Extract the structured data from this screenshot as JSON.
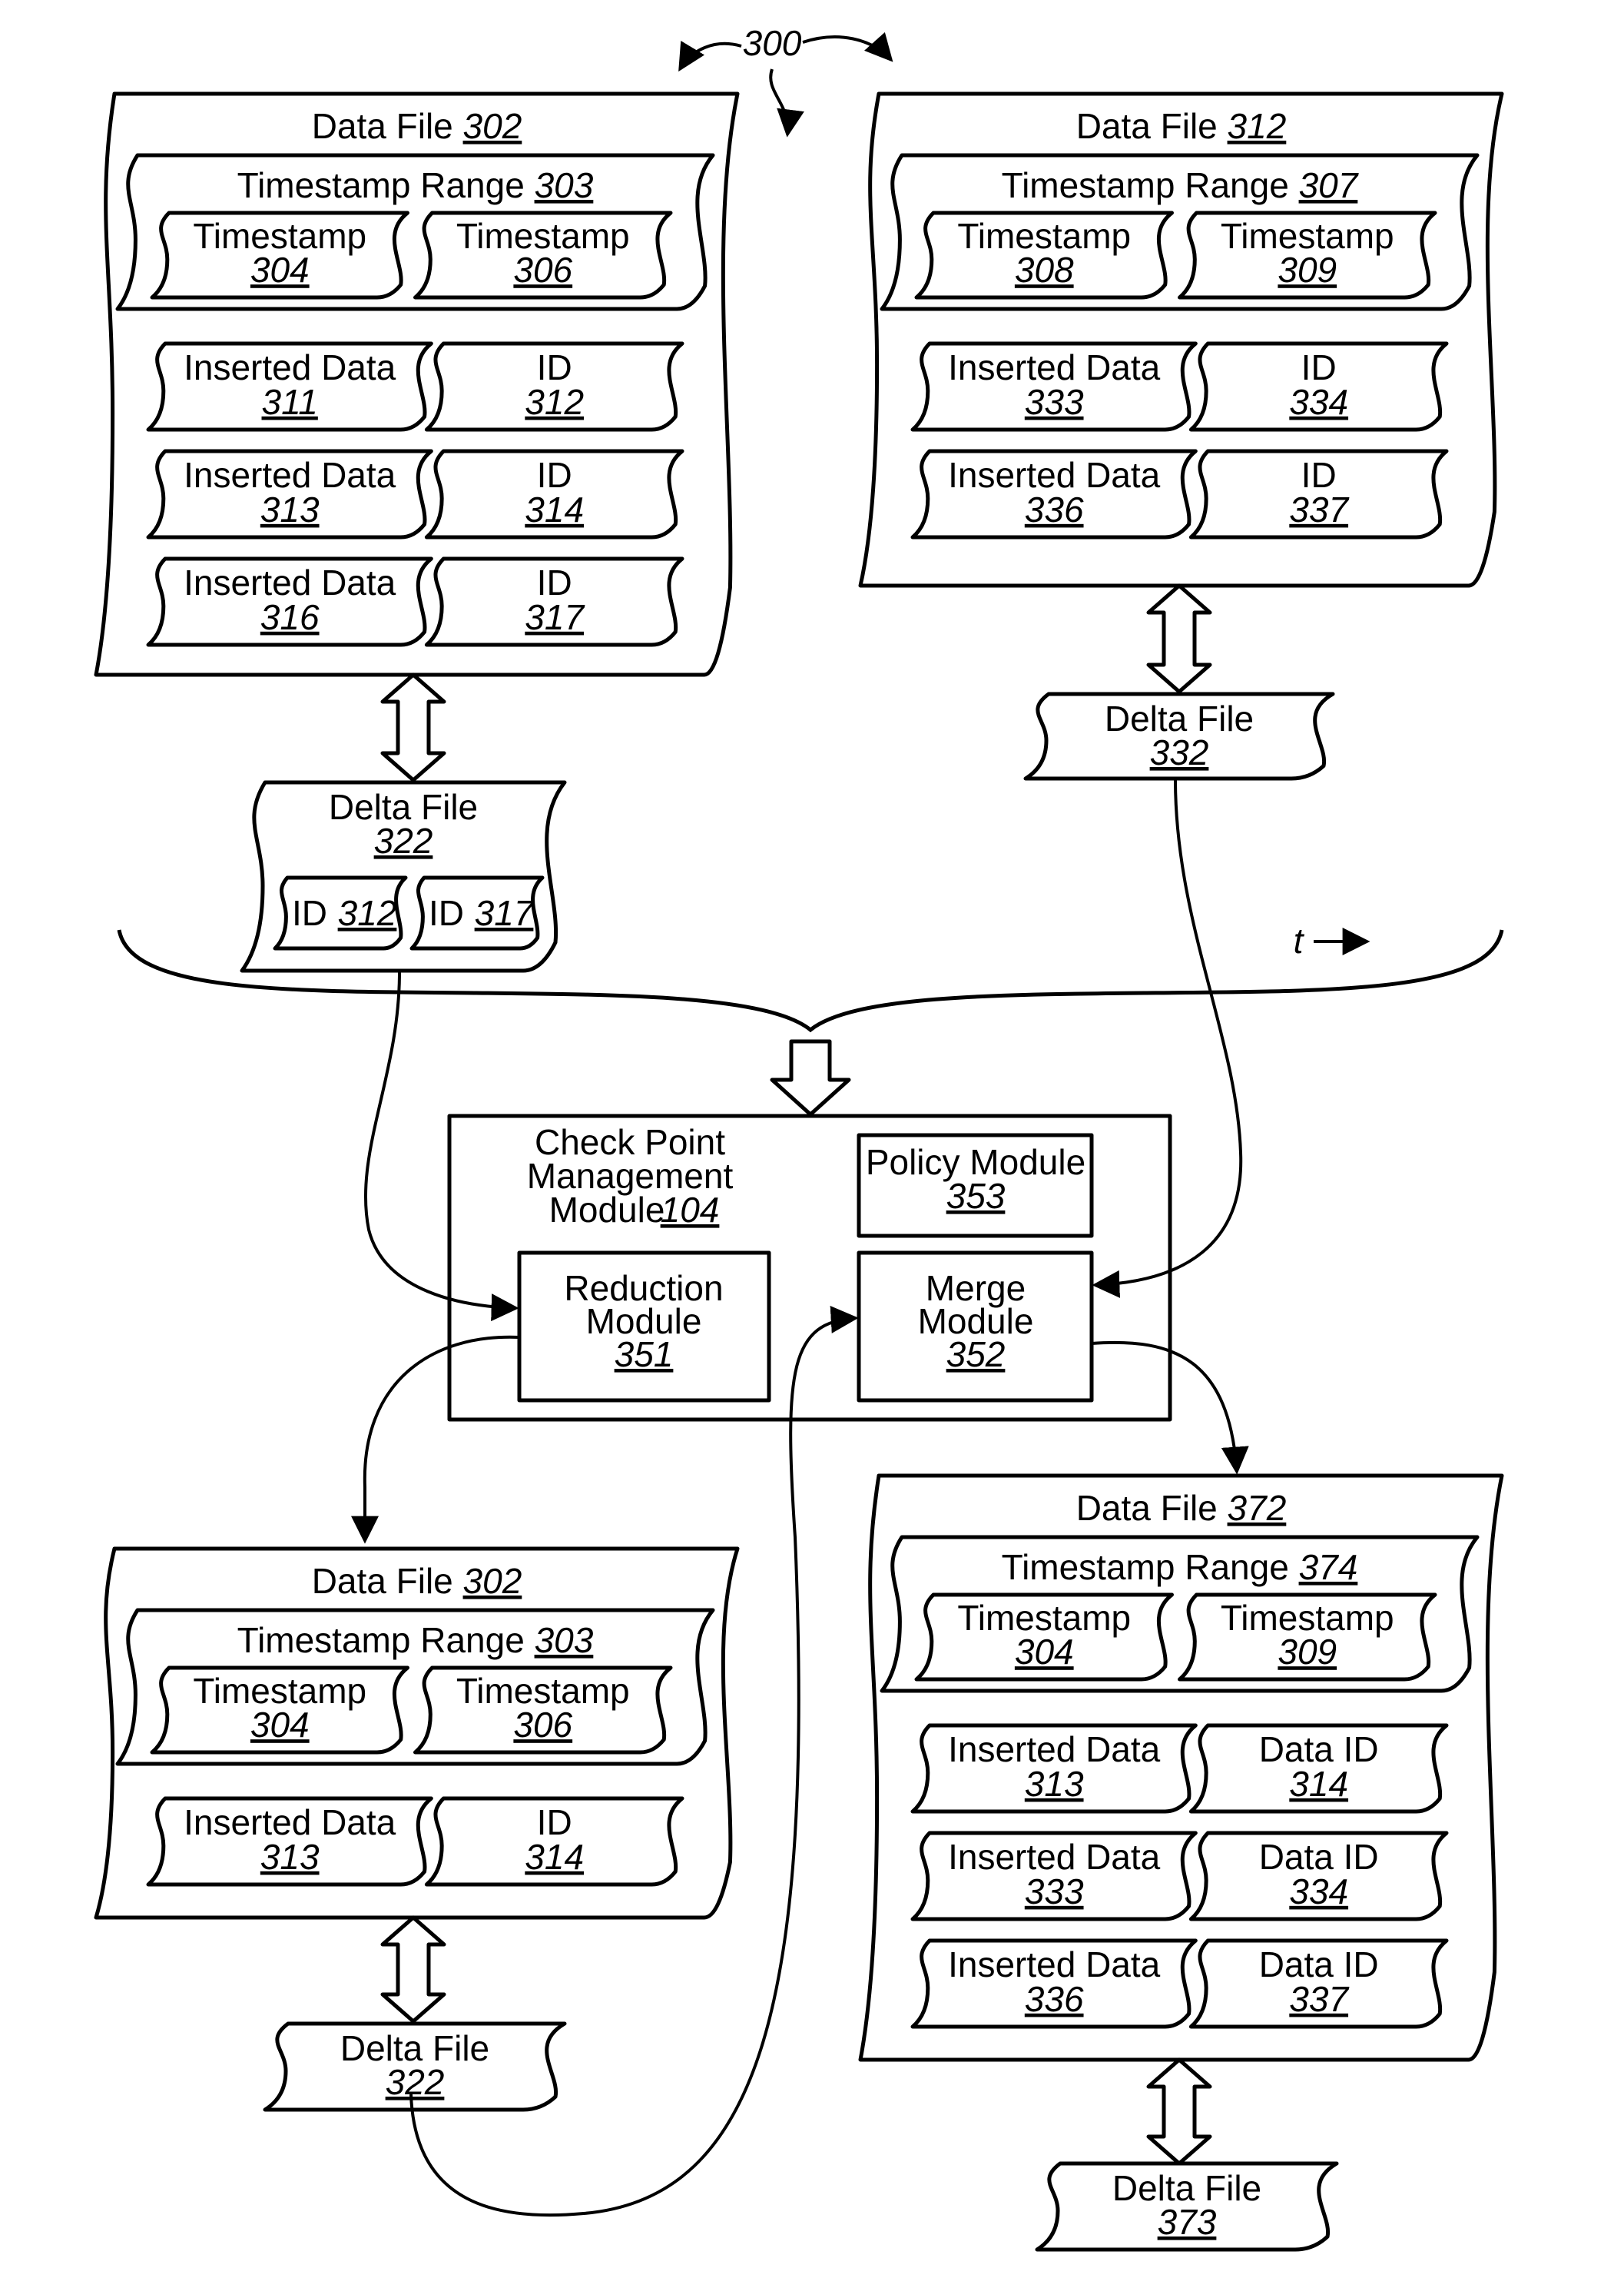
{
  "figure": {
    "ref": "300",
    "time_label": "t"
  },
  "top_left": {
    "data_file": {
      "label": "Data File",
      "ref": "302"
    },
    "range": {
      "label": "Timestamp Range",
      "ref": "303"
    },
    "timestamps": [
      {
        "label": "Timestamp",
        "ref": "304"
      },
      {
        "label": "Timestamp",
        "ref": "306"
      }
    ],
    "rows": [
      {
        "data_label": "Inserted Data",
        "data_ref": "311",
        "id_label": "ID",
        "id_ref": "312"
      },
      {
        "data_label": "Inserted Data",
        "data_ref": "313",
        "id_label": "ID",
        "id_ref": "314"
      },
      {
        "data_label": "Inserted Data",
        "data_ref": "316",
        "id_label": "ID",
        "id_ref": "317"
      }
    ],
    "delta": {
      "label": "Delta File",
      "ref": "322",
      "ids": [
        {
          "label": "ID",
          "ref": "312"
        },
        {
          "label": "ID",
          "ref": "317"
        }
      ]
    }
  },
  "top_right": {
    "data_file": {
      "label": "Data File",
      "ref": "312"
    },
    "range": {
      "label": "Timestamp Range",
      "ref": "307"
    },
    "timestamps": [
      {
        "label": "Timestamp",
        "ref": "308"
      },
      {
        "label": "Timestamp",
        "ref": "309"
      }
    ],
    "rows": [
      {
        "data_label": "Inserted Data",
        "data_ref": "333",
        "id_label": "ID",
        "id_ref": "334"
      },
      {
        "data_label": "Inserted Data",
        "data_ref": "336",
        "id_label": "ID",
        "id_ref": "337"
      }
    ],
    "delta": {
      "label": "Delta File",
      "ref": "332"
    }
  },
  "module": {
    "title_lines": [
      "Check Point",
      "Management",
      "Module"
    ],
    "ref": "104",
    "policy": {
      "label": "Policy Module",
      "ref": "353"
    },
    "reduction": {
      "lines": [
        "Reduction",
        "Module"
      ],
      "ref": "351"
    },
    "merge": {
      "lines": [
        "Merge",
        "Module"
      ],
      "ref": "352"
    }
  },
  "bottom_left": {
    "data_file": {
      "label": "Data File",
      "ref": "302"
    },
    "range": {
      "label": "Timestamp Range",
      "ref": "303"
    },
    "timestamps": [
      {
        "label": "Timestamp",
        "ref": "304"
      },
      {
        "label": "Timestamp",
        "ref": "306"
      }
    ],
    "rows": [
      {
        "data_label": "Inserted Data",
        "data_ref": "313",
        "id_label": "ID",
        "id_ref": "314"
      }
    ],
    "delta": {
      "label": "Delta File",
      "ref": "322"
    }
  },
  "bottom_right": {
    "data_file": {
      "label": "Data File",
      "ref": "372"
    },
    "range": {
      "label": "Timestamp Range",
      "ref": "374"
    },
    "timestamps": [
      {
        "label": "Timestamp",
        "ref": "304"
      },
      {
        "label": "Timestamp",
        "ref": "309"
      }
    ],
    "rows": [
      {
        "data_label": "Inserted Data",
        "data_ref": "313",
        "id_label": "Data ID",
        "id_ref": "314"
      },
      {
        "data_label": "Inserted Data",
        "data_ref": "333",
        "id_label": "Data ID",
        "id_ref": "334"
      },
      {
        "data_label": "Inserted Data",
        "data_ref": "336",
        "id_label": "Data ID",
        "id_ref": "337"
      }
    ],
    "delta": {
      "label": "Delta File",
      "ref": "373"
    }
  }
}
